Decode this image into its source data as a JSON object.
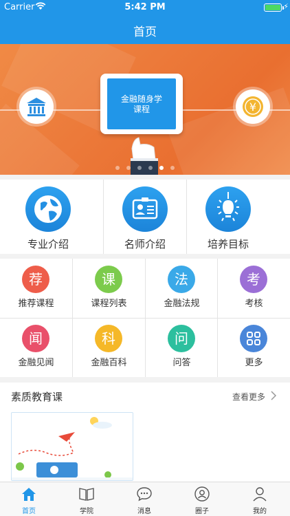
{
  "status_bar": {
    "carrier": "Carrier",
    "time": "5:42 PM"
  },
  "nav": {
    "title": "首页"
  },
  "banner": {
    "tablet_line1": "金融随身学",
    "tablet_line2": "课程",
    "page_count": 6,
    "active_page": 5,
    "coin_symbol": "¥"
  },
  "features": [
    {
      "label": "专业介绍",
      "icon": "globe-icon"
    },
    {
      "label": "名师介绍",
      "icon": "id-card-icon"
    },
    {
      "label": "培养目标",
      "icon": "lightbulb-icon"
    }
  ],
  "grid": [
    {
      "glyph": "荐",
      "label": "推荐课程",
      "color": "#ee5d4a"
    },
    {
      "glyph": "课",
      "label": "课程列表",
      "color": "#7ccb4c"
    },
    {
      "glyph": "法",
      "label": "金融法规",
      "color": "#3aa9e8"
    },
    {
      "glyph": "考",
      "label": "考核",
      "color": "#9b6fd6"
    },
    {
      "glyph": "闻",
      "label": "金融见闻",
      "color": "#e9506a"
    },
    {
      "glyph": "科",
      "label": "金融百科",
      "color": "#f5b828"
    },
    {
      "glyph": "问",
      "label": "问答",
      "color": "#2cbf9e"
    },
    {
      "glyph": "",
      "label": "更多",
      "color": "#4a86d9",
      "icon": "grid-four-icon"
    }
  ],
  "section": {
    "title": "素质教育课",
    "more": "查看更多"
  },
  "tabbar": [
    {
      "label": "首页",
      "icon": "home-icon",
      "active": true
    },
    {
      "label": "学院",
      "icon": "book-icon",
      "active": false
    },
    {
      "label": "消息",
      "icon": "chat-icon",
      "active": false
    },
    {
      "label": "圈子",
      "icon": "circle-user-icon",
      "active": false
    },
    {
      "label": "我的",
      "icon": "person-icon",
      "active": false
    }
  ],
  "colors": {
    "primary": "#2196e8",
    "banner": "#ec7a3a"
  }
}
